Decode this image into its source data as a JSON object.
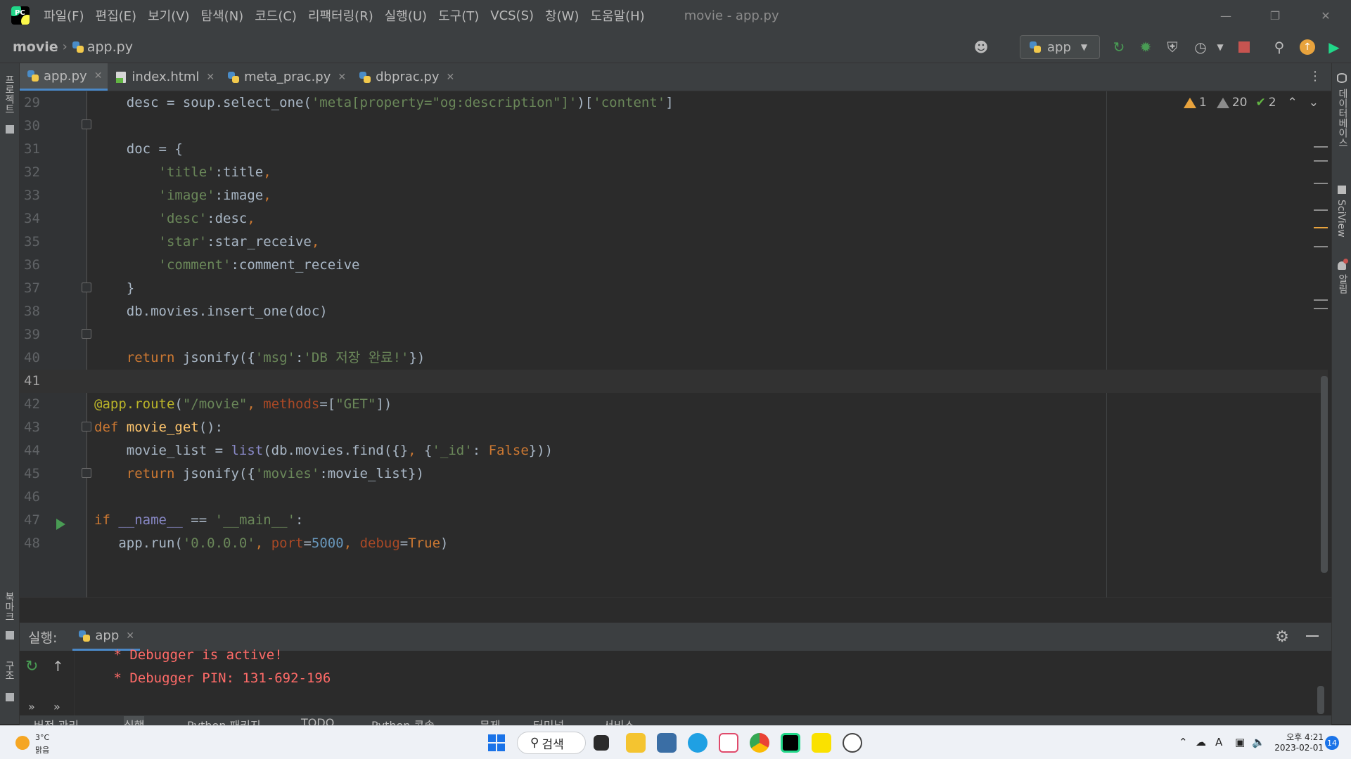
{
  "app": {
    "logo_text": "PC",
    "window_title": "movie - app.py",
    "menu": [
      "파일(F)",
      "편집(E)",
      "보기(V)",
      "탐색(N)",
      "코드(C)",
      "리팩터링(R)",
      "실행(U)",
      "도구(T)",
      "VCS(S)",
      "창(W)",
      "도움말(H)"
    ]
  },
  "navbar": {
    "project": "movie",
    "file": "app.py",
    "run_config": "app"
  },
  "left_stripe": {
    "project_label": "프로젝트",
    "bookmarks_label": "북마크",
    "structure_label": "구조"
  },
  "right_stripe": {
    "database_label": "데이터베이스",
    "sciview_label": "SciView",
    "notifications_label": "알림"
  },
  "tabs": [
    {
      "label": "app.py",
      "icon": "python-file-icon",
      "active": true
    },
    {
      "label": "index.html",
      "icon": "html-file-icon",
      "active": false
    },
    {
      "label": "meta_prac.py",
      "icon": "python-file-icon",
      "active": false
    },
    {
      "label": "dbprac.py",
      "icon": "python-file-icon",
      "active": false
    }
  ],
  "inspection": {
    "warnings": "1",
    "weak_warnings": "20",
    "typos": "2"
  },
  "editor": {
    "current_line": "41",
    "lines": [
      {
        "num": "29",
        "text": "    desc = soup.select_one('meta[property=\"og:description\"]')['content']"
      },
      {
        "num": "30",
        "text": ""
      },
      {
        "num": "31",
        "text": "    doc = {"
      },
      {
        "num": "32",
        "text": "        'title':title,"
      },
      {
        "num": "33",
        "text": "        'image':image,"
      },
      {
        "num": "34",
        "text": "        'desc':desc,"
      },
      {
        "num": "35",
        "text": "        'star':star_receive,"
      },
      {
        "num": "36",
        "text": "        'comment':comment_receive"
      },
      {
        "num": "37",
        "text": "    }"
      },
      {
        "num": "38",
        "text": "    db.movies.insert_one(doc)"
      },
      {
        "num": "39",
        "text": ""
      },
      {
        "num": "40",
        "text": "    return jsonify({'msg':'DB 저장 완료!'})"
      },
      {
        "num": "41",
        "text": ""
      },
      {
        "num": "42",
        "text": "@app.route(\"/movie\", methods=[\"GET\"])"
      },
      {
        "num": "43",
        "text": "def movie_get():"
      },
      {
        "num": "44",
        "text": "    movie_list = list(db.movies.find({}, {'_id': False}))"
      },
      {
        "num": "45",
        "text": "    return jsonify({'movies':movie_list})"
      },
      {
        "num": "46",
        "text": ""
      },
      {
        "num": "47",
        "text": "if __name__ == '__main__':"
      },
      {
        "num": "48",
        "text": "   app.run('0.0.0.0', port=5000, debug=True)"
      }
    ]
  },
  "run_panel": {
    "title": "실행:",
    "tab_label": "app",
    "console": [
      " * Debugger is active!",
      " * Debugger PIN: 131-692-196"
    ],
    "more_1": "»",
    "more_2": "»"
  },
  "bottom_bar": [
    "버전 관리",
    "실행",
    "Python 패키지",
    "TODO",
    "Python 콘솔",
    "문제",
    "터미널",
    "서비스"
  ],
  "taskbar": {
    "weather_temp": "3°C",
    "weather_desc": "맑음",
    "search_label": "검색",
    "time": "오후 4:21",
    "date": "2023-02-01",
    "notification_count": "14",
    "input_indicator": "A"
  }
}
